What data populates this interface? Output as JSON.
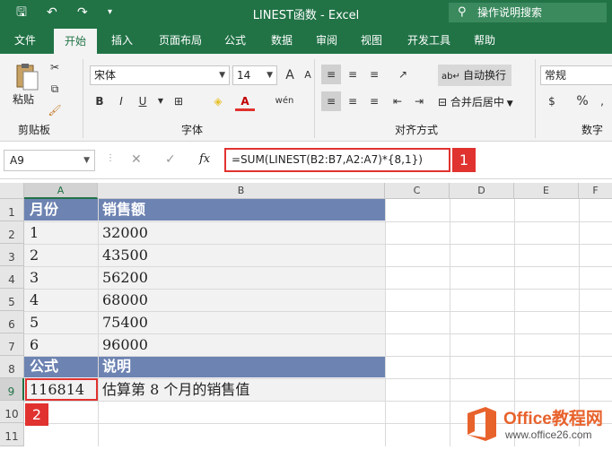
{
  "window": {
    "title": "LINEST函数 - Excel",
    "search_placeholder": "操作说明搜索"
  },
  "quick_access": {
    "save": "🖫",
    "undo": "↶",
    "redo": "↷",
    "more": "▾"
  },
  "tabs": [
    "文件",
    "开始",
    "插入",
    "页面布局",
    "公式",
    "数据",
    "审阅",
    "视图",
    "开发工具",
    "帮助"
  ],
  "active_tab": "开始",
  "ribbon": {
    "paste_label": "粘贴",
    "clipboard_group": "剪贴板",
    "font_name": "宋体",
    "font_size": "14",
    "font_group": "字体",
    "bold": "B",
    "italic": "I",
    "underline": "U",
    "grow_font": "A",
    "shrink_font": "A",
    "font_color": "A",
    "phonetic": "wén",
    "wrap_text": "自动换行",
    "merge_center": "合并后居中",
    "align_group": "对齐方式",
    "number_format": "常规",
    "number_group": "数字",
    "percent": "%"
  },
  "formula_bar": {
    "name_box": "A9",
    "cancel": "✕",
    "enter": "✓",
    "fx": "fx",
    "formula": "=SUM(LINEST(B2:B7,A2:A7)*{8,1})"
  },
  "callouts": {
    "one": "1",
    "two": "2"
  },
  "columns": [
    "A",
    "B",
    "C",
    "D",
    "E",
    "F"
  ],
  "rows": [
    "1",
    "2",
    "3",
    "4",
    "5",
    "6",
    "7",
    "8",
    "9",
    "10",
    "11"
  ],
  "cells": {
    "r1": {
      "a": "月份",
      "b": "销售额"
    },
    "data": [
      {
        "a": "1",
        "b": "32000"
      },
      {
        "a": "2",
        "b": "43500"
      },
      {
        "a": "3",
        "b": "56200"
      },
      {
        "a": "4",
        "b": "68000"
      },
      {
        "a": "5",
        "b": "75400"
      },
      {
        "a": "6",
        "b": "96000"
      }
    ],
    "r8": {
      "a": "公式",
      "b": "说明"
    },
    "r9": {
      "a": "116814",
      "b": "估算第 8 个月的销售值"
    }
  },
  "watermark": {
    "brand": "Office教程网",
    "url": "www.office26.com"
  },
  "colors": {
    "excel_green": "#217346",
    "header_band": "#6d83b2",
    "highlight_red": "#e0322f",
    "logo_orange": "#e8622c"
  }
}
